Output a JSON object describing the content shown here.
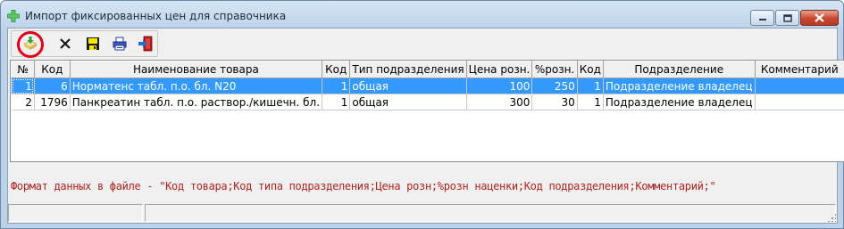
{
  "window": {
    "title": "Импорт фиксированных цен для справочника"
  },
  "toolbar": {
    "buttons": [
      {
        "name": "import",
        "icon": "import-file-icon"
      },
      {
        "name": "delete",
        "icon": "delete-x-icon"
      },
      {
        "name": "save",
        "icon": "floppy-save-icon"
      },
      {
        "name": "print",
        "icon": "printer-icon"
      },
      {
        "name": "exit",
        "icon": "exit-door-icon"
      }
    ]
  },
  "table": {
    "columns": [
      "№",
      "Код",
      "Наименование товара",
      "Код",
      "Тип подразделения",
      "Цена розн.",
      "%розн.",
      "Код",
      "Подразделение",
      "Комментарий"
    ],
    "rows": [
      [
        "1",
        "6",
        "Норматенс табл. п.о. бл. N20",
        "1",
        "общая",
        "100",
        "250",
        "1",
        "Подразделение владелец",
        ""
      ],
      [
        "2",
        "1796",
        "Панкреатин табл. п.о. раствор./кишечн. бл.",
        "1",
        "общая",
        "300",
        "30",
        "1",
        "Подразделение владелец",
        ""
      ]
    ],
    "selected_row": 0
  },
  "format_hint": "Формат данных в файле - \"Код товара;Код типа подразделения;Цена розн;%розн наценки;Код подразделения;Комментарий;\"",
  "colors": {
    "selection": "#3399ff",
    "hint_text": "#b22222",
    "highlight_ring": "#e2001a"
  }
}
